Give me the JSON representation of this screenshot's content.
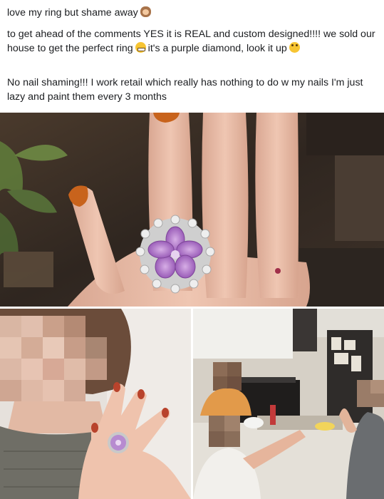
{
  "post": {
    "line1": "love my ring but shame away",
    "para2_a": "to get ahead of the comments YES it is REAL and custom designed!!!! we sold our house to get the perfect ring",
    "para2_b": "it's a purple diamond, look it up",
    "para3": "No nail shaming!!! I work retail which really has nothing to do w my nails I'm just lazy and paint them every 3 months"
  },
  "emojis": [
    "see-no-evil-monkey-icon",
    "grimacing-face-icon",
    "rolling-eyes-face-icon"
  ],
  "photos": [
    {
      "name": "ring-closeup-photo",
      "subject": "hand with orange nail polish wearing purple flower ring"
    },
    {
      "name": "selfie-ring-photo",
      "subject": "person showing ring on hand, face pixelated"
    },
    {
      "name": "kitchen-reaction-photo",
      "subject": "people in kitchen reacting, faces pixelated"
    }
  ],
  "colors": {
    "text": "#1c1e21",
    "ring_stone": "#b57fd0",
    "nail_polish": "#c8631c"
  }
}
